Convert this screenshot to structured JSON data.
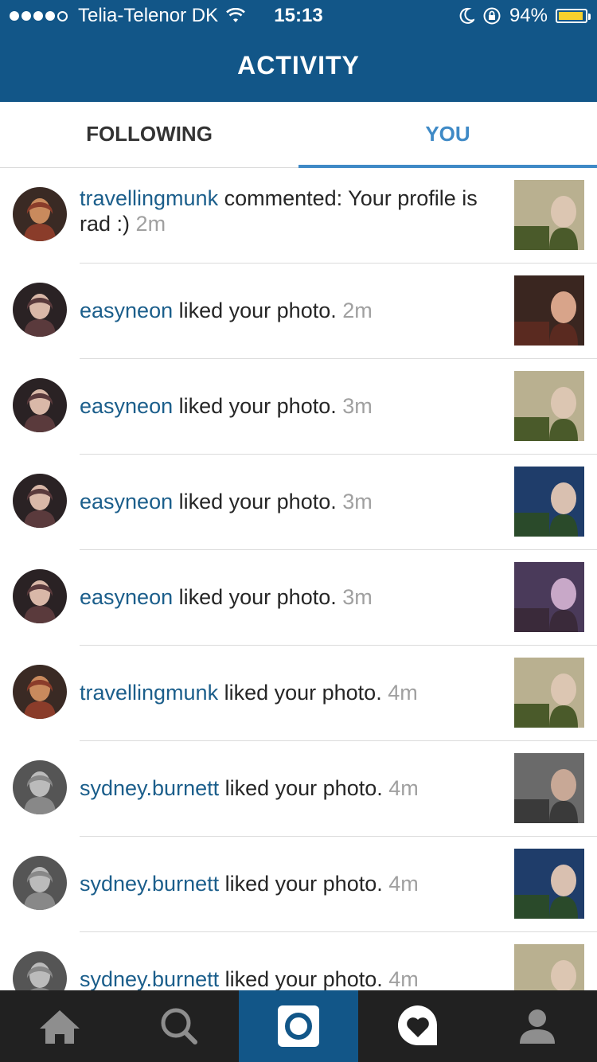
{
  "status_bar": {
    "carrier": "Telia-Telenor DK",
    "time": "15:13",
    "battery": "94%",
    "battery_level": 0.94,
    "signal_bars": 4
  },
  "header": {
    "title": "ACTIVITY"
  },
  "tabs": [
    {
      "label": "FOLLOWING",
      "active": false
    },
    {
      "label": "YOU",
      "active": true
    }
  ],
  "activities": [
    {
      "user": "travellingmunk",
      "action": " commented: Your profile  is  rad :)",
      "time": "2m"
    },
    {
      "user": "easyneon",
      "action": " liked your photo.",
      "time": "2m"
    },
    {
      "user": "easyneon",
      "action": " liked your photo.",
      "time": "3m"
    },
    {
      "user": "easyneon",
      "action": " liked your photo.",
      "time": "3m"
    },
    {
      "user": "easyneon",
      "action": " liked your photo.",
      "time": "3m"
    },
    {
      "user": "travellingmunk",
      "action": " liked your photo.",
      "time": "4m"
    },
    {
      "user": "sydney.burnett",
      "action": " liked your photo.",
      "time": "4m"
    },
    {
      "user": "sydney.burnett",
      "action": " liked your photo.",
      "time": "4m"
    },
    {
      "user": "sydney.burnett",
      "action": " liked your photo.",
      "time": "4m"
    }
  ],
  "bottom_nav": [
    {
      "icon": "home-icon",
      "active": false
    },
    {
      "icon": "search-icon",
      "active": false
    },
    {
      "icon": "camera-icon",
      "active": true
    },
    {
      "icon": "activity-heart-icon",
      "active": false
    },
    {
      "icon": "profile-icon",
      "active": false
    }
  ],
  "colors": {
    "brand": "#125688",
    "active_tab": "#3f8ac6",
    "username": "#1b5e8b",
    "timestamp": "#a0a0a0"
  }
}
